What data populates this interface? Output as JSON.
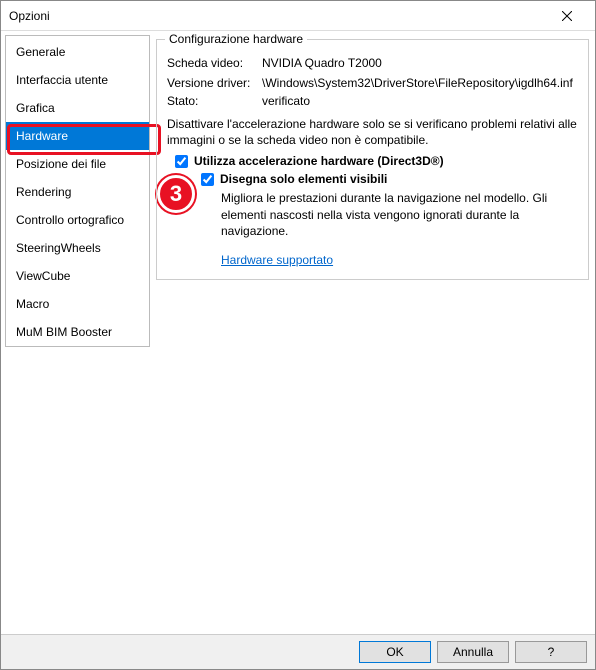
{
  "window": {
    "title": "Opzioni"
  },
  "sidebar": {
    "items": [
      {
        "label": "Generale"
      },
      {
        "label": "Interfaccia utente"
      },
      {
        "label": "Grafica"
      },
      {
        "label": "Hardware"
      },
      {
        "label": "Posizione dei file"
      },
      {
        "label": "Rendering"
      },
      {
        "label": "Controllo ortografico"
      },
      {
        "label": "SteeringWheels"
      },
      {
        "label": "ViewCube"
      },
      {
        "label": "Macro"
      },
      {
        "label": "MuM BIM Booster"
      }
    ],
    "selected_index": 3
  },
  "annotation": {
    "badge": "3"
  },
  "panel": {
    "group_title": "Configurazione hardware",
    "video_card_label": "Scheda video:",
    "video_card_value": "NVIDIA Quadro T2000",
    "driver_version_label": "Versione driver:",
    "driver_version_value": "\\Windows\\System32\\DriverStore\\FileRepository\\igdlh64.inf",
    "state_label": "Stato:",
    "state_value": "verificato",
    "disable_desc": "Disattivare l'accelerazione hardware solo se si verificano problemi relativi alle immagini o se la scheda video non è compatibile.",
    "use_accel_label": "Utilizza accelerazione hardware (Direct3D®)",
    "use_accel_checked": true,
    "draw_visible_label": "Disegna solo elementi visibili",
    "draw_visible_checked": true,
    "draw_visible_desc": "Migliora le prestazioni durante la navigazione nel modello. Gli elementi nascosti nella vista vengono ignorati durante la navigazione.",
    "supported_link": "Hardware supportato"
  },
  "footer": {
    "ok": "OK",
    "cancel": "Annulla",
    "help": "?"
  }
}
